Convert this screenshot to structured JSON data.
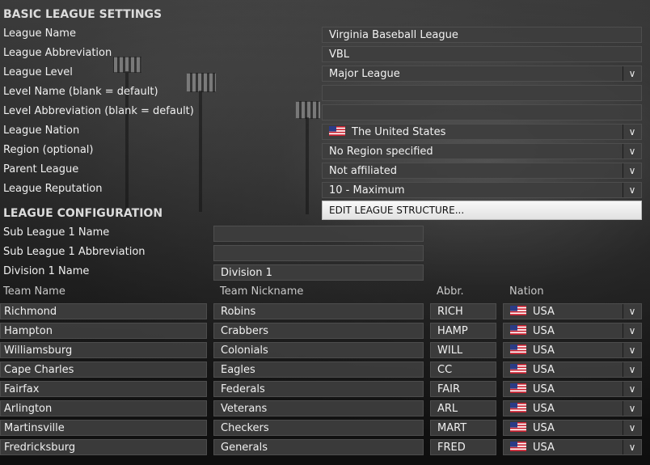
{
  "basic": {
    "title": "BASIC LEAGUE SETTINGS",
    "league_name_label": "League Name",
    "league_name": "Virginia Baseball League",
    "abbr_label": "League Abbreviation",
    "abbr": "VBL",
    "level_label": "League Level",
    "level": "Major League",
    "level_name_label": "Level Name (blank = default)",
    "level_name": "",
    "level_abbr_label": "Level Abbreviation (blank = default)",
    "level_abbr": "",
    "nation_label": "League Nation",
    "nation": "The United States",
    "region_label": "Region (optional)",
    "region": "No Region specified",
    "parent_label": "Parent League",
    "parent": "Not affiliated",
    "reputation_label": "League Reputation",
    "reputation": "10 - Maximum"
  },
  "config": {
    "title": "LEAGUE CONFIGURATION",
    "edit_button": "EDIT LEAGUE STRUCTURE...",
    "sub1_name_label": "Sub League 1 Name",
    "sub1_name": "",
    "sub1_abbr_label": "Sub League 1 Abbreviation",
    "sub1_abbr": "",
    "div1_name_label": "Division 1 Name",
    "div1_name": "Division 1"
  },
  "teams": {
    "headers": {
      "name": "Team Name",
      "nickname": "Team Nickname",
      "abbr": "Abbr.",
      "nation": "Nation"
    },
    "rows": [
      {
        "name": "Richmond",
        "nickname": "Robins",
        "abbr": "RICH",
        "nation": "USA"
      },
      {
        "name": "Hampton",
        "nickname": "Crabbers",
        "abbr": "HAMP",
        "nation": "USA"
      },
      {
        "name": "Williamsburg",
        "nickname": "Colonials",
        "abbr": "WILL",
        "nation": "USA"
      },
      {
        "name": "Cape Charles",
        "nickname": "Eagles",
        "abbr": "CC",
        "nation": "USA"
      },
      {
        "name": "Fairfax",
        "nickname": "Federals",
        "abbr": "FAIR",
        "nation": "USA"
      },
      {
        "name": "Arlington",
        "nickname": "Veterans",
        "abbr": "ARL",
        "nation": "USA"
      },
      {
        "name": "Martinsville",
        "nickname": "Checkers",
        "abbr": "MART",
        "nation": "USA"
      },
      {
        "name": "Fredricksburg",
        "nickname": "Generals",
        "abbr": "FRED",
        "nation": "USA"
      }
    ]
  },
  "icons": {
    "dropdown": "chevron-down-icon",
    "flag": "us-flag-icon"
  },
  "colors": {
    "field_bg": "#3e3e3e",
    "button_bg": "#f0f0f0",
    "text": "#f0f0f0"
  }
}
